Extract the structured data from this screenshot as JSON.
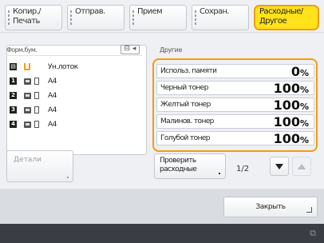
{
  "tabs": [
    {
      "line1": "Копир./",
      "line2": "Печать",
      "active": false
    },
    {
      "line1": "Отправ.",
      "line2": "",
      "active": false
    },
    {
      "line1": "Прием",
      "line2": "",
      "active": false
    },
    {
      "line1": "Сохран.",
      "line2": "",
      "active": false
    },
    {
      "line1": "Расходные/",
      "line2": "Другое",
      "active": true
    }
  ],
  "paper": {
    "header": "Форм.бум.",
    "layout_icon": "⊟ ◂",
    "bypass_label": "Ун.лоток",
    "rows": [
      {
        "num": "1",
        "size": "A4"
      },
      {
        "num": "2",
        "size": "A4"
      },
      {
        "num": "3",
        "size": "A4"
      },
      {
        "num": "4",
        "size": "A4"
      }
    ]
  },
  "other": {
    "header": "Другие",
    "items": [
      {
        "name": "Использ. памяти",
        "value": "0",
        "unit": "%"
      },
      {
        "name": "Черный тонер",
        "value": "100",
        "unit": "%"
      },
      {
        "name": "Желтый тонер",
        "value": "100",
        "unit": "%"
      },
      {
        "name": "Малинов. тонер",
        "value": "100",
        "unit": "%"
      },
      {
        "name": "Голубой тонер",
        "value": "100",
        "unit": "%"
      }
    ]
  },
  "controls": {
    "details_label": "Детали",
    "check_line1": "Проверить",
    "check_line2": "расходные",
    "page": "1/2",
    "close_label": "Закрыть"
  },
  "colors": {
    "accent": "#f39c12",
    "active_tab": "#ffe21a"
  },
  "status": {
    "icon": "status-icon"
  }
}
